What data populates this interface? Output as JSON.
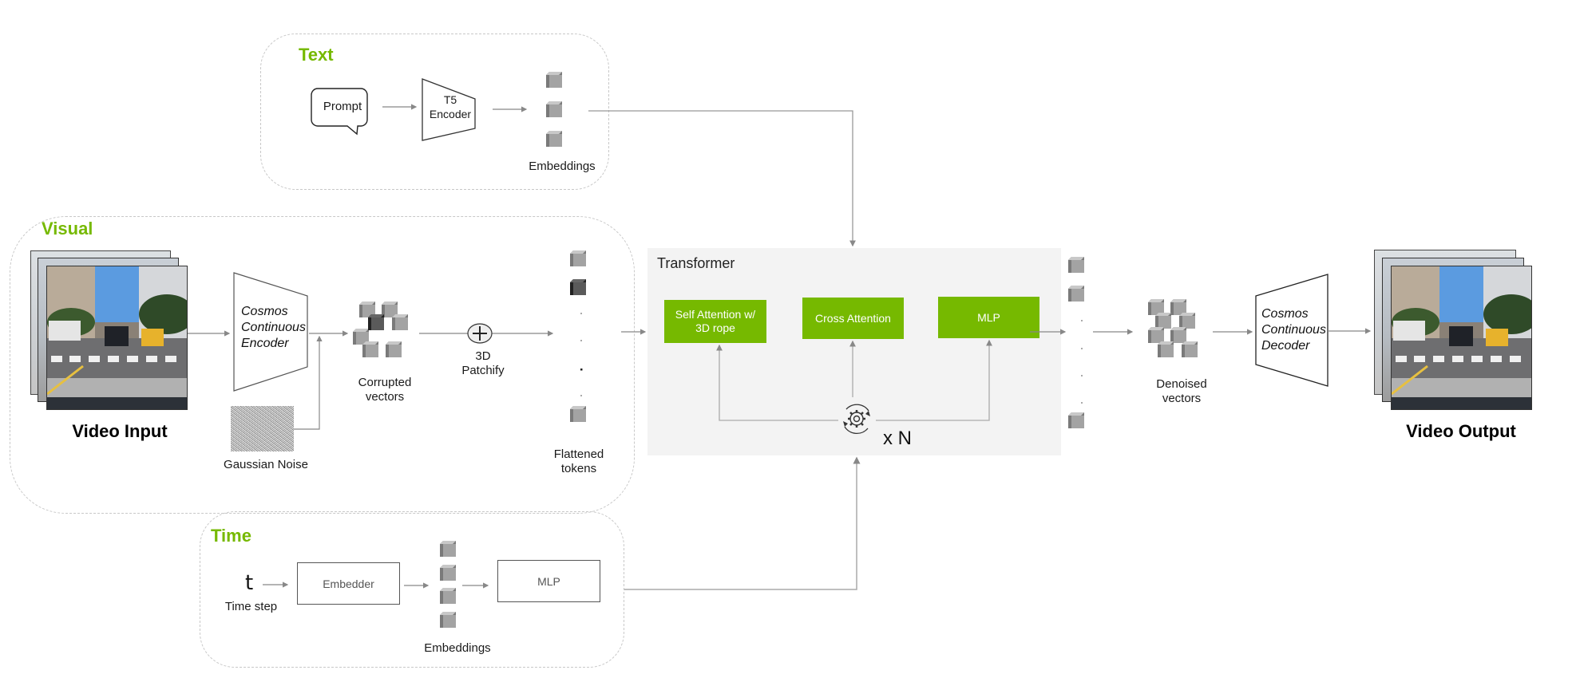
{
  "colors": {
    "accent": "#76b900",
    "transformer_bg": "#f3f3f3",
    "cube": "#a0a0a0",
    "cube_dark": "#3a3a3a"
  },
  "text_section": {
    "title": "Text",
    "prompt": "Prompt",
    "encoder": [
      "T5",
      "Encoder"
    ],
    "embeddings": "Embeddings"
  },
  "visual_section": {
    "title": "Visual",
    "video_input": "Video Input",
    "encoder": [
      "Cosmos",
      "Continuous",
      "Encoder"
    ],
    "noise": "Gaussian Noise",
    "corrupted": [
      "Corrupted",
      "vectors"
    ],
    "patchify": [
      "3D",
      "Patchify"
    ],
    "flattened": [
      "Flattened",
      "tokens"
    ]
  },
  "transformer": {
    "title": "Transformer",
    "blocks": [
      {
        "label": [
          "Self Attention w/",
          "3D rope"
        ]
      },
      {
        "label": [
          "Cross Attention"
        ]
      },
      {
        "label": [
          "MLP"
        ]
      }
    ],
    "repeat": "x N"
  },
  "output": {
    "denoised": [
      "Denoised",
      "vectors"
    ],
    "decoder": [
      "Cosmos",
      "Continuous",
      "Decoder"
    ],
    "video_output": "Video Output"
  },
  "time_section": {
    "title": "Time",
    "t_symbol": "t",
    "time_step": "Time step",
    "embedder": "Embedder",
    "embeddings": "Embeddings",
    "mlp": "MLP"
  },
  "icons": {
    "gear": "gear-cycle-icon",
    "plus": "circled-plus-icon",
    "cube": "cube-icon",
    "speech": "speech-bubble-icon"
  }
}
